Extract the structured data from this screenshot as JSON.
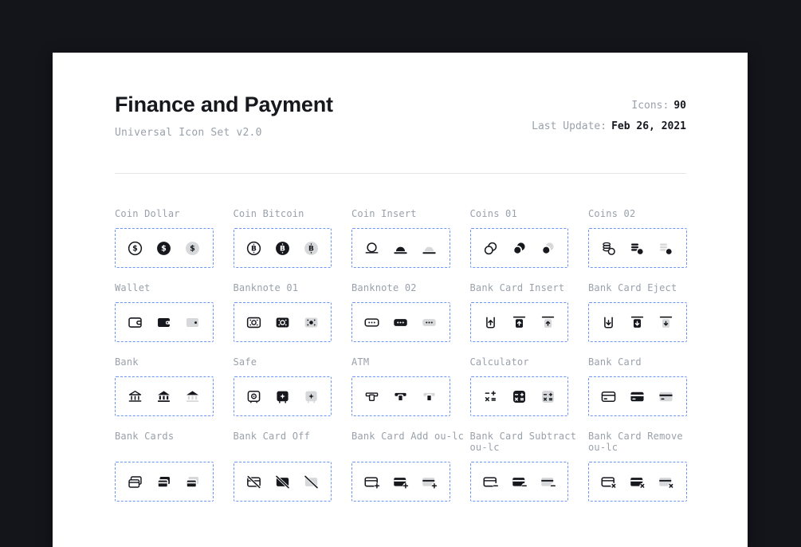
{
  "page": {
    "title": "Finance and Payment",
    "subtitle": "Universal Icon Set v2.0",
    "meta": {
      "icons_label": "Icons:",
      "icons_count": "90",
      "last_update_label": "Last Update:",
      "last_update_value": "Feb 26, 2021"
    }
  },
  "colors": {
    "frame_background": "#14151b",
    "card_background": "#ffffff",
    "icon_ink": "#16181e",
    "duotone_gray": "#d7d8da",
    "label_gray": "#9aa1ab",
    "dashed_border_blue": "#6d95f6",
    "divider": "#e5e6e8"
  },
  "variants": [
    "outline",
    "filled",
    "duotone"
  ],
  "groups": [
    {
      "label": "Coin Dollar",
      "icons": [
        "coin-dollar-outline",
        "coin-dollar-filled",
        "coin-dollar-duotone"
      ]
    },
    {
      "label": "Coin Bitcoin",
      "icons": [
        "coin-bitcoin-outline",
        "coin-bitcoin-filled",
        "coin-bitcoin-duotone"
      ]
    },
    {
      "label": "Coin Insert",
      "icons": [
        "coin-insert-outline",
        "coin-insert-filled",
        "coin-insert-duotone"
      ]
    },
    {
      "label": "Coins 01",
      "icons": [
        "coins-01-outline",
        "coins-01-filled",
        "coins-01-duotone"
      ]
    },
    {
      "label": "Coins 02",
      "icons": [
        "coins-02-outline",
        "coins-02-filled",
        "coins-02-duotone"
      ]
    },
    {
      "label": "Wallet",
      "icons": [
        "wallet-outline",
        "wallet-filled",
        "wallet-duotone"
      ]
    },
    {
      "label": "Banknote 01",
      "icons": [
        "banknote-01-outline",
        "banknote-01-filled",
        "banknote-01-duotone"
      ]
    },
    {
      "label": "Banknote 02",
      "icons": [
        "banknote-02-outline",
        "banknote-02-filled",
        "banknote-02-duotone"
      ]
    },
    {
      "label": "Bank Card Insert",
      "icons": [
        "bank-card-insert-outline",
        "bank-card-insert-filled",
        "bank-card-insert-duotone"
      ]
    },
    {
      "label": "Bank Card Eject",
      "icons": [
        "bank-card-eject-outline",
        "bank-card-eject-filled",
        "bank-card-eject-duotone"
      ]
    },
    {
      "label": "Bank",
      "icons": [
        "bank-outline",
        "bank-filled",
        "bank-duotone"
      ]
    },
    {
      "label": "Safe",
      "icons": [
        "safe-outline",
        "safe-filled",
        "safe-duotone"
      ]
    },
    {
      "label": "ATM",
      "icons": [
        "atm-outline",
        "atm-filled",
        "atm-duotone"
      ]
    },
    {
      "label": "Calculator",
      "icons": [
        "calculator-outline",
        "calculator-filled",
        "calculator-duotone"
      ]
    },
    {
      "label": "Bank Card",
      "icons": [
        "bank-card-outline",
        "bank-card-filled",
        "bank-card-duotone"
      ]
    },
    {
      "label": "Bank Cards",
      "icons": [
        "bank-cards-outline",
        "bank-cards-filled",
        "bank-cards-duotone"
      ]
    },
    {
      "label": "Bank Card Off",
      "icons": [
        "bank-card-off-outline",
        "bank-card-off-filled",
        "bank-card-off-duotone"
      ]
    },
    {
      "label": "Bank Card Add ou-lc",
      "icons": [
        "bank-card-add-outline",
        "bank-card-add-filled",
        "bank-card-add-duotone"
      ]
    },
    {
      "label": "Bank Card Subtract ou-lc",
      "icons": [
        "bank-card-subtract-outline",
        "bank-card-subtract-filled",
        "bank-card-subtract-duotone"
      ]
    },
    {
      "label": "Bank Card Remove ou-lc",
      "icons": [
        "bank-card-remove-outline",
        "bank-card-remove-filled",
        "bank-card-remove-duotone"
      ]
    }
  ]
}
